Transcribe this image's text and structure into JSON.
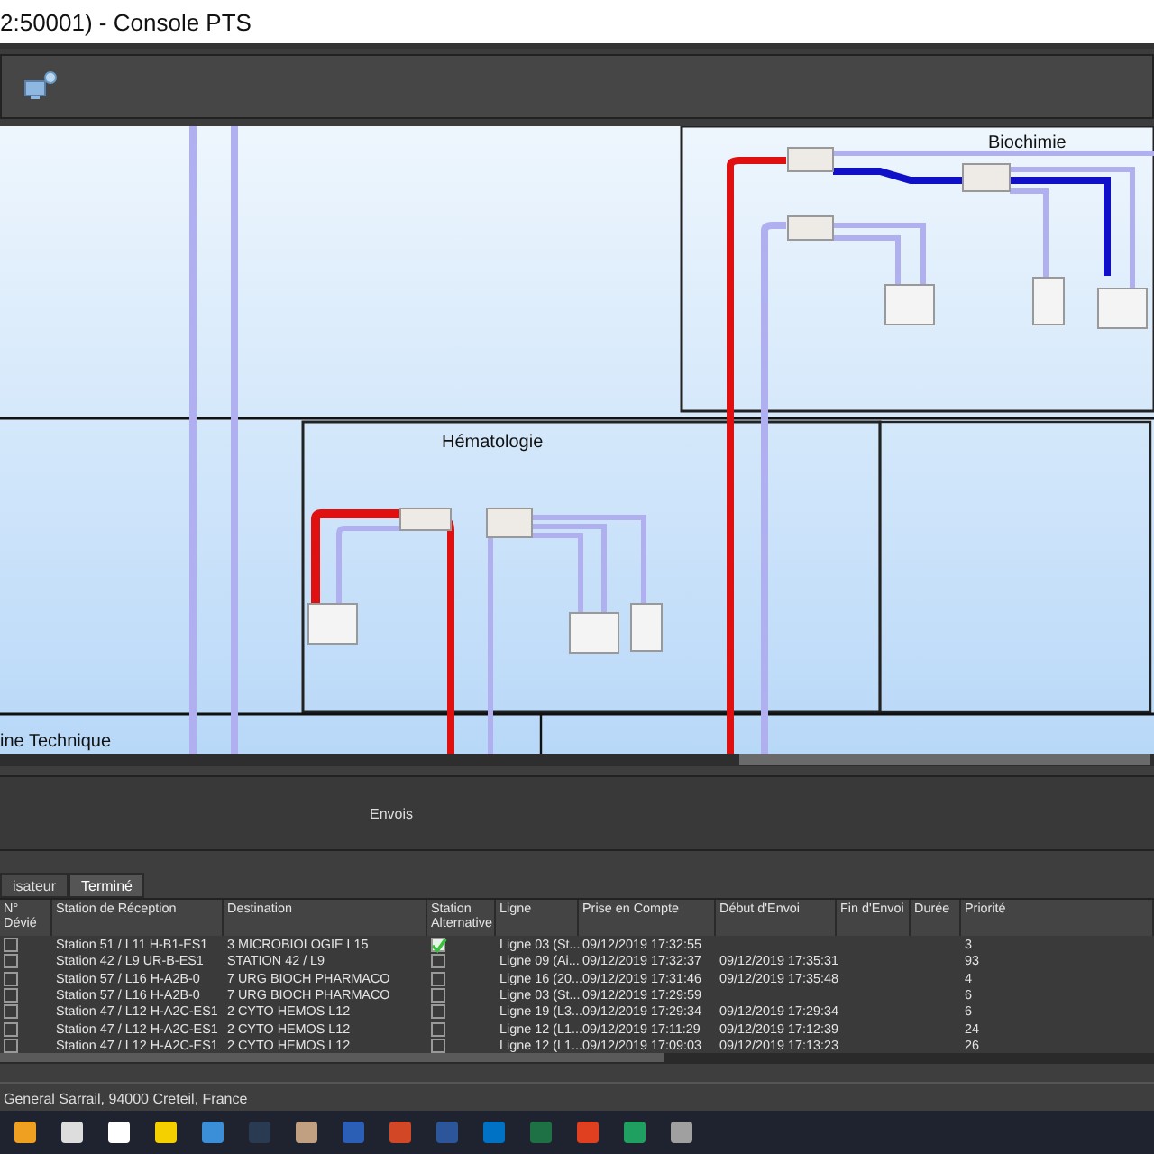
{
  "window": {
    "title": "2:50001) - Console PTS"
  },
  "diagram": {
    "rooms": [
      "Biochimie",
      "Hématologie",
      "ine Technique"
    ]
  },
  "panel": {
    "title": "Envois"
  },
  "tabs": [
    {
      "label": "isateur",
      "selected": false
    },
    {
      "label": "Terminé",
      "selected": true
    }
  ],
  "table": {
    "columns": [
      "N° Dévié",
      "Station de Réception",
      "Destination",
      "Station Alternative",
      "Ligne",
      "Prise en Compte",
      "Début d'Envoi",
      "Fin d'Envoi",
      "Durée",
      "Priorité"
    ],
    "rows": [
      {
        "devie": false,
        "station": "Station 51  /  L11    H-B1-ES1",
        "destination": "3 MICROBIOLOGIE L15",
        "alternative": true,
        "ligne": "Ligne 03 (St...",
        "prise": "09/12/2019 17:32:55",
        "debut": "",
        "priorite": "3"
      },
      {
        "devie": false,
        "station": "Station 42  /  L9   UR-B-ES1",
        "destination": "STATION 42 / L9",
        "alternative": false,
        "ligne": "Ligne 09 (Ai...",
        "prise": "09/12/2019 17:32:37",
        "debut": "09/12/2019 17:35:31",
        "priorite": "93"
      },
      {
        "devie": false,
        "station": "Station  57  /  L16    H-A2B-0",
        "destination": "7 URG BIOCH PHARMACO",
        "alternative": false,
        "ligne": "Ligne 16 (20...",
        "prise": "09/12/2019 17:31:46",
        "debut": "09/12/2019 17:35:48",
        "priorite": "4"
      },
      {
        "devie": false,
        "station": "Station  57  /  L16    H-A2B-0",
        "destination": "7 URG BIOCH PHARMACO",
        "alternative": false,
        "ligne": "Ligne 03 (St...",
        "prise": "09/12/2019 17:29:59",
        "debut": "",
        "priorite": "6"
      },
      {
        "devie": false,
        "station": "Station 47  /  L12    H-A2C-ES1",
        "destination": "2 CYTO HEMOS L12",
        "alternative": false,
        "ligne": "Ligne 19 (L3...",
        "prise": "09/12/2019 17:29:34",
        "debut": "09/12/2019 17:29:34",
        "priorite": "6"
      },
      {
        "devie": false,
        "station": "Station 47  /  L12    H-A2C-ES1",
        "destination": "2 CYTO HEMOS L12",
        "alternative": false,
        "ligne": "Ligne 12 (L1...",
        "prise": "09/12/2019 17:11:29",
        "debut": "09/12/2019 17:12:39",
        "priorite": "24"
      },
      {
        "devie": false,
        "station": "Station 47  /  L12    H-A2C-ES1",
        "destination": "2 CYTO HEMOS L12",
        "alternative": false,
        "ligne": "Ligne 12 (L1...",
        "prise": "09/12/2019 17:09:03",
        "debut": "09/12/2019 17:13:23",
        "priorite": "26"
      }
    ]
  },
  "status_bar": {
    "address": "General Sarrail, 94000 Creteil, France"
  }
}
